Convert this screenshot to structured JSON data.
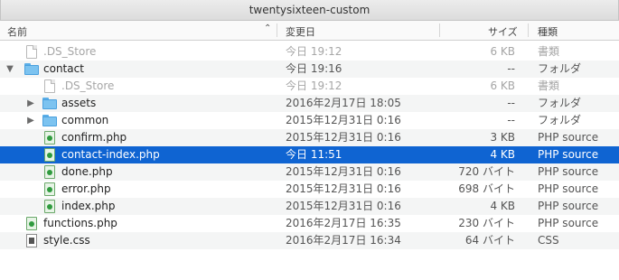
{
  "window": {
    "title": "twentysixteen-custom"
  },
  "columns": {
    "name": "名前",
    "date": "変更日",
    "size": "サイズ",
    "kind": "種類"
  },
  "rows": [
    {
      "name": ".DS_Store",
      "date": "今日 19:12",
      "size": "6 KB",
      "kind": "書類",
      "icon": "document-icon",
      "dim": true
    },
    {
      "name": "contact",
      "date": "今日 19:16",
      "size": "--",
      "kind": "フォルダ",
      "icon": "folder-icon",
      "disclosure": "expanded"
    },
    {
      "name": ".DS_Store",
      "date": "今日 19:12",
      "size": "6 KB",
      "kind": "書類",
      "icon": "document-icon",
      "dim": true
    },
    {
      "name": "assets",
      "date": "2016年2月17日 18:05",
      "size": "--",
      "kind": "フォルダ",
      "icon": "folder-icon",
      "disclosure": "collapsed"
    },
    {
      "name": "common",
      "date": "2015年12月31日 0:16",
      "size": "--",
      "kind": "フォルダ",
      "icon": "folder-icon",
      "disclosure": "collapsed"
    },
    {
      "name": "confirm.php",
      "date": "2015年12月31日 0:16",
      "size": "3 KB",
      "kind": "PHP source",
      "icon": "php-file-icon"
    },
    {
      "name": "contact-index.php",
      "date": "今日 11:51",
      "size": "4 KB",
      "kind": "PHP source",
      "icon": "php-file-icon",
      "selected": true
    },
    {
      "name": "done.php",
      "date": "2015年12月31日 0:16",
      "size": "720 バイト",
      "kind": "PHP source",
      "icon": "php-file-icon"
    },
    {
      "name": "error.php",
      "date": "2015年12月31日 0:16",
      "size": "698 バイト",
      "kind": "PHP source",
      "icon": "php-file-icon"
    },
    {
      "name": "index.php",
      "date": "2015年12月31日 0:16",
      "size": "4 KB",
      "kind": "PHP source",
      "icon": "php-file-icon"
    },
    {
      "name": "functions.php",
      "date": "2016年2月17日 16:35",
      "size": "230 バイト",
      "kind": "PHP source",
      "icon": "php-file-icon"
    },
    {
      "name": "style.css",
      "date": "2016年2月17日 16:34",
      "size": "64 バイト",
      "kind": "CSS",
      "icon": "css-file-icon"
    }
  ],
  "colors": {
    "selection": "#0f64d2",
    "stripe": "#f4f5f5",
    "folder": "#7cc3f0",
    "php": "#2f9b3e"
  }
}
